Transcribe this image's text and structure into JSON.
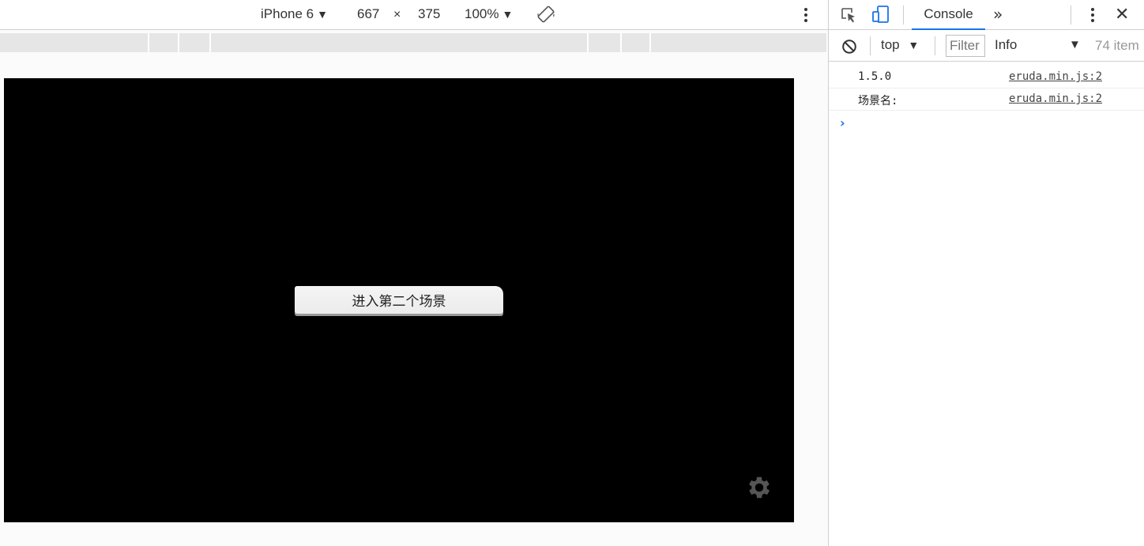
{
  "device_toolbar": {
    "device": "iPhone 6",
    "width": "667",
    "times": "×",
    "height": "375",
    "zoom": "100%",
    "dropdown_arrow": "▼"
  },
  "viewport": {
    "background": "#000000",
    "scene_button_label": "进入第二个场景"
  },
  "devtools": {
    "tab_label": "Console",
    "more_tabs": "»",
    "close": "✕",
    "context": "top",
    "filter_placeholder": "Filter",
    "level": "Info",
    "item_count": "74 item",
    "accent": "#1a73e8"
  },
  "console": {
    "logs": [
      {
        "message": "1.5.0",
        "source": "eruda.min.js:2"
      },
      {
        "message": "场景名:",
        "source": "eruda.min.js:2"
      }
    ],
    "prompt": "›"
  }
}
